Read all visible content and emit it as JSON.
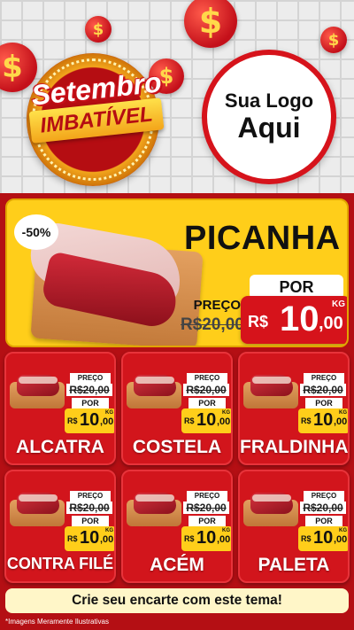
{
  "campaign": {
    "badge_top": "Setembro",
    "badge_bottom": "IMBATÍVEL",
    "logo_line1": "Sua Logo",
    "logo_line2": "Aqui"
  },
  "featured": {
    "discount": "-50%",
    "name": "PICANHA",
    "preco_label": "PREÇO",
    "old_price": "R$20,00",
    "por_label": "POR",
    "currency": "R$",
    "price_int": "10",
    "price_dec": ",00",
    "unit": "KG"
  },
  "products": [
    {
      "name": "ALCATRA",
      "preco_label": "PREÇO",
      "old_price": "R$20,00",
      "por_label": "POR",
      "currency": "R$",
      "price_int": "10",
      "price_dec": ",00",
      "unit": "KG"
    },
    {
      "name": "COSTELA",
      "preco_label": "PREÇO",
      "old_price": "R$20,00",
      "por_label": "POR",
      "currency": "R$",
      "price_int": "10",
      "price_dec": ",00",
      "unit": "KG"
    },
    {
      "name": "FRALDINHA",
      "preco_label": "PREÇO",
      "old_price": "R$20,00",
      "por_label": "POR",
      "currency": "R$",
      "price_int": "10",
      "price_dec": ",00",
      "unit": "KG"
    },
    {
      "name": "CONTRA FILÉ",
      "preco_label": "PREÇO",
      "old_price": "R$20,00",
      "por_label": "POR",
      "currency": "R$",
      "price_int": "10",
      "price_dec": ",00",
      "unit": "KG"
    },
    {
      "name": "ACÉM",
      "preco_label": "PREÇO",
      "old_price": "R$20,00",
      "por_label": "POR",
      "currency": "R$",
      "price_int": "10",
      "price_dec": ",00",
      "unit": "KG"
    },
    {
      "name": "PALETA",
      "preco_label": "PREÇO",
      "old_price": "R$20,00",
      "por_label": "POR",
      "currency": "R$",
      "price_int": "10",
      "price_dec": ",00",
      "unit": "KG"
    }
  ],
  "cta": "Crie seu encarte com este tema!",
  "footnote": "*Imagens Meramente Ilustrativas",
  "icons": [
    "dollar-coin-icon"
  ],
  "colors": {
    "primary_red": "#d6131b",
    "accent_yellow": "#ffce1a",
    "background_red": "#b40f14"
  }
}
